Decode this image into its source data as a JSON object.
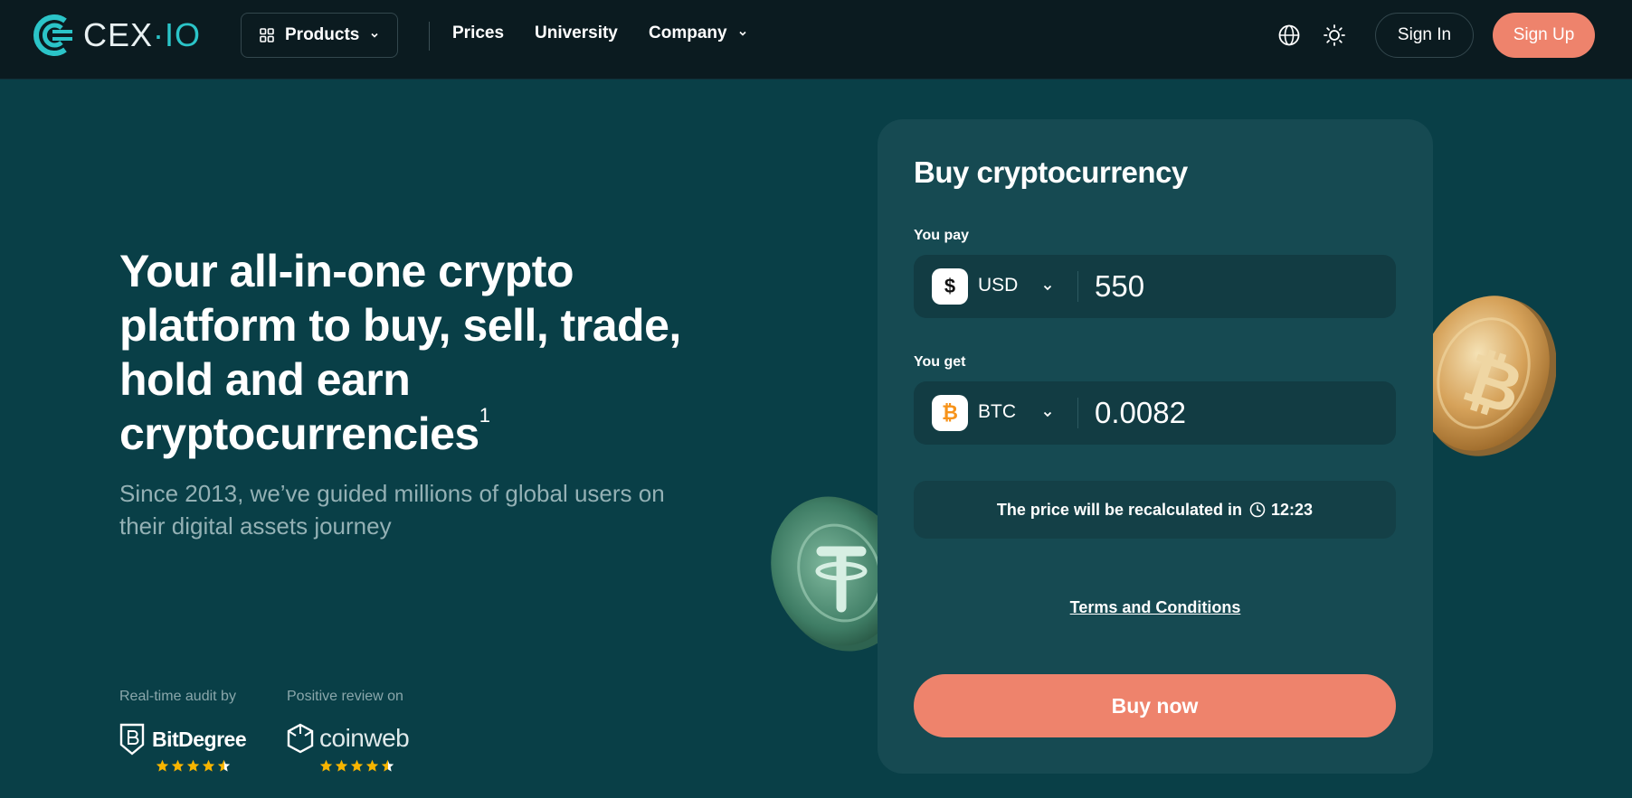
{
  "header": {
    "logo_text": "CEX",
    "logo_text_suffix": "IO",
    "products_label": "Products",
    "nav": [
      "Prices",
      "University",
      "Company"
    ],
    "sign_in": "Sign In",
    "sign_up": "Sign Up",
    "icons": [
      "globe-icon",
      "sun-icon"
    ]
  },
  "hero": {
    "title": "Your all-in-one crypto platform to buy, sell, trade, hold and earn cryptocurrencies",
    "title_sup": "1",
    "subtitle": "Since 2013, we’ve guided millions of global users on their digital assets journey",
    "audit_label": "Real-time audit by",
    "audit_brand": "BitDegree",
    "review_label": "Positive review on",
    "review_brand": "coinweb"
  },
  "widget": {
    "title": "Buy cryptocurrency",
    "pay_label": "You pay",
    "pay_currency": "USD",
    "pay_currency_symbol": "$",
    "pay_amount": "550",
    "get_label": "You get",
    "get_currency": "BTC",
    "get_currency_symbol": "₿",
    "get_amount": "0.0082",
    "recalc_text": "The price will be recalculated in",
    "timer": "12:23",
    "terms": "Terms and Conditions",
    "buy_button": "Buy now"
  },
  "colors": {
    "background": "#093f47",
    "header": "#0b1b20",
    "card": "#164a52",
    "accent": "#ee836c",
    "brand_teal": "#2bc4c8"
  }
}
